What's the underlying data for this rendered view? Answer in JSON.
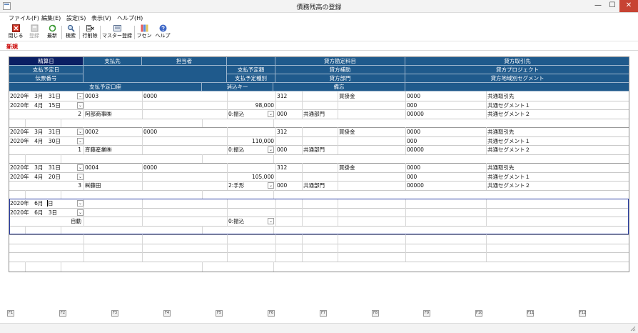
{
  "window": {
    "title": "債務残高の登録",
    "min_glyph": "—",
    "max_glyph": "☐",
    "close_glyph": "✕"
  },
  "menu": [
    "ファイル(F)",
    "編集(E)",
    "設定(S)",
    "表示(V)",
    "ヘルプ(H)"
  ],
  "toolbar": {
    "close": "閉じる",
    "register": "登録",
    "refresh": "最新",
    "search": "検索",
    "delete_row": "行削除",
    "master_register": "マスター登録",
    "fusen": "フセン",
    "help": "ヘルプ"
  },
  "mode_label": "新規",
  "headers": {
    "settlement_date": "精算日",
    "payee": "支払先",
    "person": "担当者",
    "payment_amount": "支払予定額",
    "credit_account": "貸方勘定科目",
    "credit_customer": "貸方取引先",
    "payment_date": "支払予定日",
    "payment_type": "支払予定種別",
    "credit_aux": "貸方補助",
    "credit_project": "貸方プロジェクト",
    "slip_no": "伝票番号",
    "credit_dept": "貸方部門",
    "credit_region": "貸方地域別セグメント",
    "payment_bank": "支払予定口座",
    "clear_key": "消込キー",
    "memo": "備忘"
  },
  "records": [
    {
      "settle_date": "2020年　3月　31日",
      "pay_date": "2020年　4月　15日",
      "slip_no": "2",
      "payee_code": "0003",
      "person_code": "0000",
      "payee_name": "阿部商事㈱",
      "amount": "98,000",
      "pay_type": "0:振込",
      "account_code": "312",
      "account_name": "買掛金",
      "dept_code": "000",
      "dept_name": "共通部門",
      "customer_code": "0000",
      "aux_code": "000",
      "region_code": "00000",
      "customer_name": "共通取引先",
      "project_name": "共通セグメント１",
      "region_name": "共通セグメント２"
    },
    {
      "settle_date": "2020年　3月　31日",
      "pay_date": "2020年　4月　30日",
      "slip_no": "1",
      "payee_code": "0002",
      "person_code": "0000",
      "payee_name": "斉藤産業㈱",
      "amount": "110,000",
      "pay_type": "0:振込",
      "account_code": "312",
      "account_name": "買掛金",
      "dept_code": "000",
      "dept_name": "共通部門",
      "customer_code": "0000",
      "aux_code": "000",
      "region_code": "00000",
      "customer_name": "共通取引先",
      "project_name": "共通セグメント１",
      "region_name": "共通セグメント２"
    },
    {
      "settle_date": "2020年　3月　31日",
      "pay_date": "2020年　4月　20日",
      "slip_no": "3",
      "payee_code": "0004",
      "person_code": "0000",
      "payee_name": "㈱藤田",
      "amount": "105,000",
      "pay_type": "2:手形",
      "account_code": "312",
      "account_name": "買掛金",
      "dept_code": "000",
      "dept_name": "共通部門",
      "customer_code": "0000",
      "aux_code": "000",
      "region_code": "00000",
      "customer_name": "共通取引先",
      "project_name": "共通セグメント１",
      "region_name": "共通セグメント２"
    }
  ],
  "new_row": {
    "settle_date_a": "2020年　6月　",
    "settle_date_b": "日",
    "pay_date": "2020年　6月　3日",
    "slip_no": "自動",
    "pay_type": "0:振込"
  },
  "fkeys": [
    "F1",
    "F2",
    "F3",
    "F4",
    "F5",
    "F6",
    "F7",
    "F8",
    "F9",
    "F10",
    "F11",
    "F12"
  ],
  "colors": {
    "header": "#1f5a8c",
    "header_dark": "#0b1f63",
    "selection": "#2c3fa4",
    "mode": "#c80000"
  }
}
